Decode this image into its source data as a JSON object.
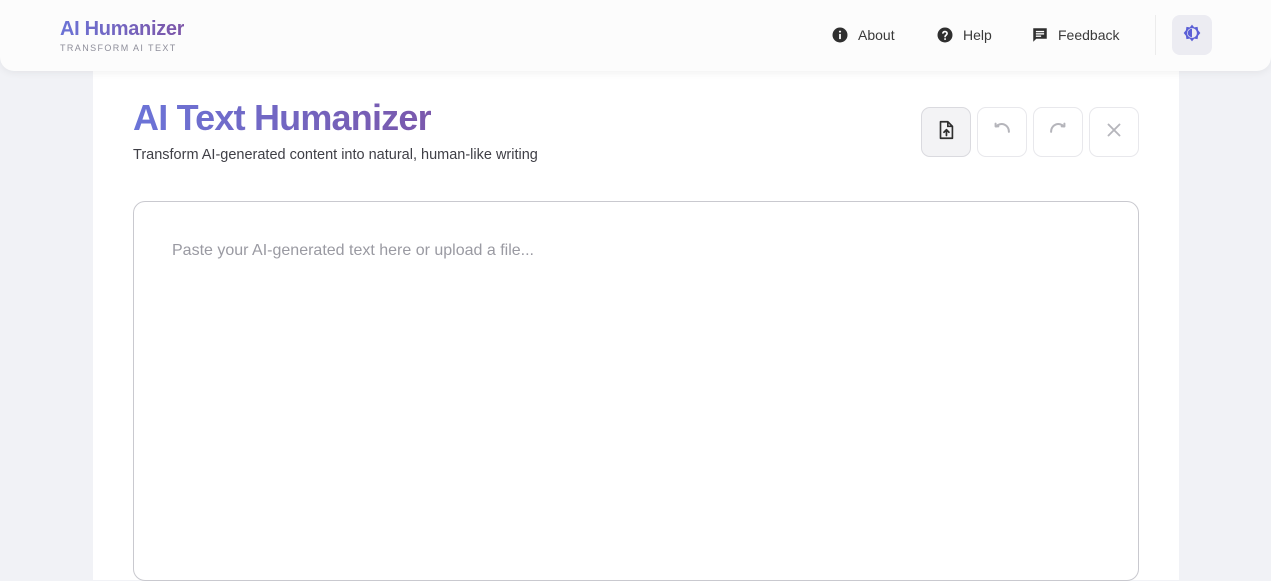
{
  "brand": {
    "title": "AI Humanizer",
    "subtitle": "TRANSFORM AI TEXT"
  },
  "nav": {
    "items": [
      {
        "label": "About",
        "icon": "info-icon"
      },
      {
        "label": "Help",
        "icon": "help-icon"
      },
      {
        "label": "Feedback",
        "icon": "feedback-icon"
      }
    ],
    "theme_toggle_icon": "brightness-icon"
  },
  "main": {
    "title": "AI Text Humanizer",
    "subtitle": "Transform AI-generated content into natural, human-like writing",
    "toolbar": [
      {
        "icon": "upload-file-icon",
        "active": true
      },
      {
        "icon": "undo-icon",
        "active": false
      },
      {
        "icon": "redo-icon",
        "active": false
      },
      {
        "icon": "clear-icon",
        "active": false
      }
    ],
    "editor": {
      "value": "",
      "placeholder": "Paste your AI-generated text here or upload a file..."
    }
  },
  "colors": {
    "brand_start": "#6b74d8",
    "brand_end": "#7a58ac",
    "theme_icon": "#5b5fd6",
    "background": "#f1f2f6"
  }
}
